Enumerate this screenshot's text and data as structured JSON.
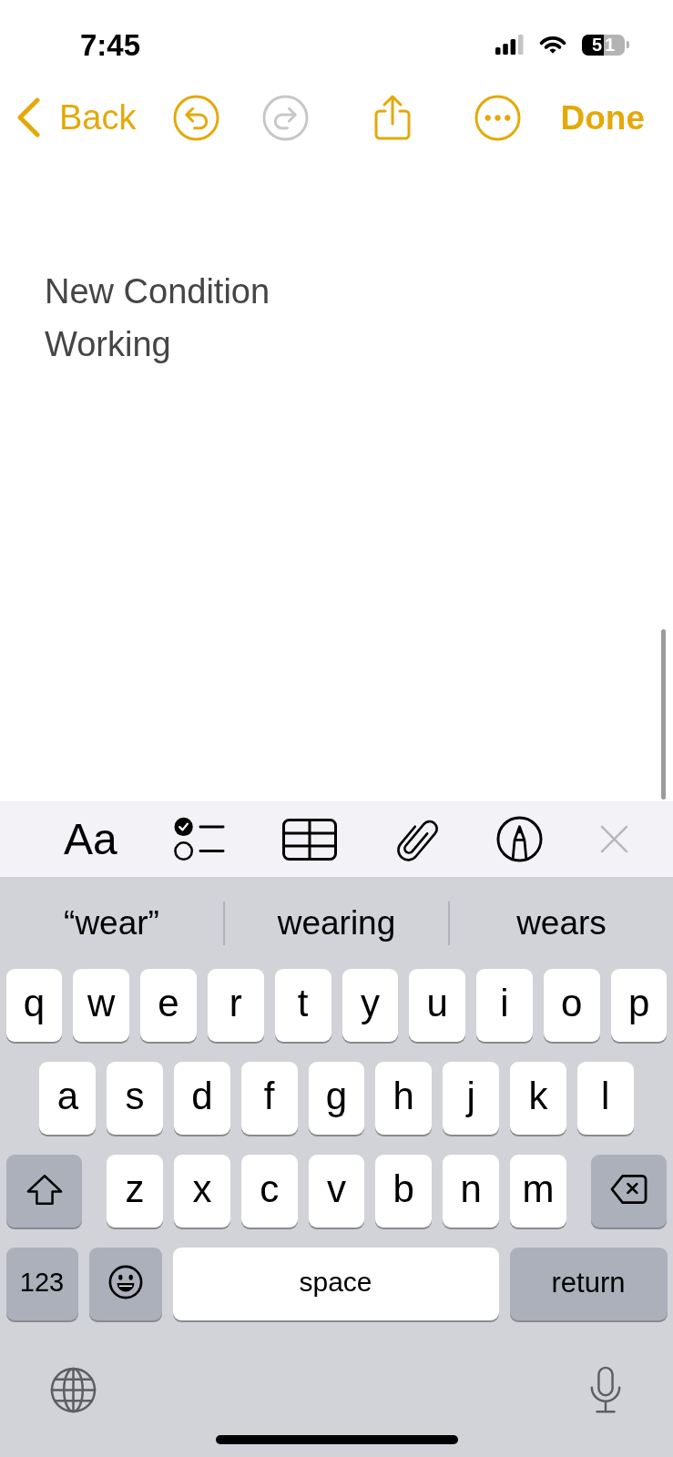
{
  "status_bar": {
    "time": "7:45",
    "battery": "51"
  },
  "nav_bar": {
    "back": "Back",
    "actions": [
      {
        "kind": "undo",
        "disabled": false
      },
      {
        "kind": "redo",
        "disabled": true
      },
      {
        "kind": "share",
        "disabled": false
      },
      {
        "kind": "more",
        "disabled": false
      }
    ],
    "done": "Done"
  },
  "note": {
    "lines": [
      "New Condition",
      "Working"
    ]
  },
  "format_toolbar": [
    {
      "kind": "text_style",
      "label": "Aa"
    },
    {
      "kind": "checklist"
    },
    {
      "kind": "table"
    },
    {
      "kind": "attachment"
    },
    {
      "kind": "markup"
    },
    {
      "kind": "close"
    }
  ],
  "keyboard": {
    "suggestions": [
      "“wear”",
      "wearing",
      "wears"
    ],
    "letter_rows": [
      {
        "keys": [
          {
            "kind": "letter",
            "label": "q"
          },
          {
            "kind": "letter",
            "label": "w"
          },
          {
            "kind": "letter",
            "label": "e"
          },
          {
            "kind": "letter",
            "label": "r"
          },
          {
            "kind": "letter",
            "label": "t"
          },
          {
            "kind": "letter",
            "label": "y"
          },
          {
            "kind": "letter",
            "label": "u"
          },
          {
            "kind": "letter",
            "label": "i"
          },
          {
            "kind": "letter",
            "label": "o"
          },
          {
            "kind": "letter",
            "label": "p"
          }
        ]
      },
      {
        "keys": [
          {
            "kind": "letter",
            "label": "a"
          },
          {
            "kind": "letter",
            "label": "s"
          },
          {
            "kind": "letter",
            "label": "d"
          },
          {
            "kind": "letter",
            "label": "f"
          },
          {
            "kind": "letter",
            "label": "g"
          },
          {
            "kind": "letter",
            "label": "h"
          },
          {
            "kind": "letter",
            "label": "j"
          },
          {
            "kind": "letter",
            "label": "k"
          },
          {
            "kind": "letter",
            "label": "l"
          }
        ]
      },
      {
        "keys": [
          {
            "kind": "shift"
          },
          {
            "kind": "letter",
            "label": "z"
          },
          {
            "kind": "letter",
            "label": "x"
          },
          {
            "kind": "letter",
            "label": "c"
          },
          {
            "kind": "letter",
            "label": "v"
          },
          {
            "kind": "letter",
            "label": "b"
          },
          {
            "kind": "letter",
            "label": "n"
          },
          {
            "kind": "letter",
            "label": "m"
          },
          {
            "kind": "delete"
          }
        ]
      }
    ],
    "function_row": {
      "numbers_key": "123",
      "space_key": "space",
      "return_key": "return"
    },
    "bottom_controls": [
      {
        "kind": "globe"
      },
      {
        "kind": "dictation"
      }
    ]
  }
}
